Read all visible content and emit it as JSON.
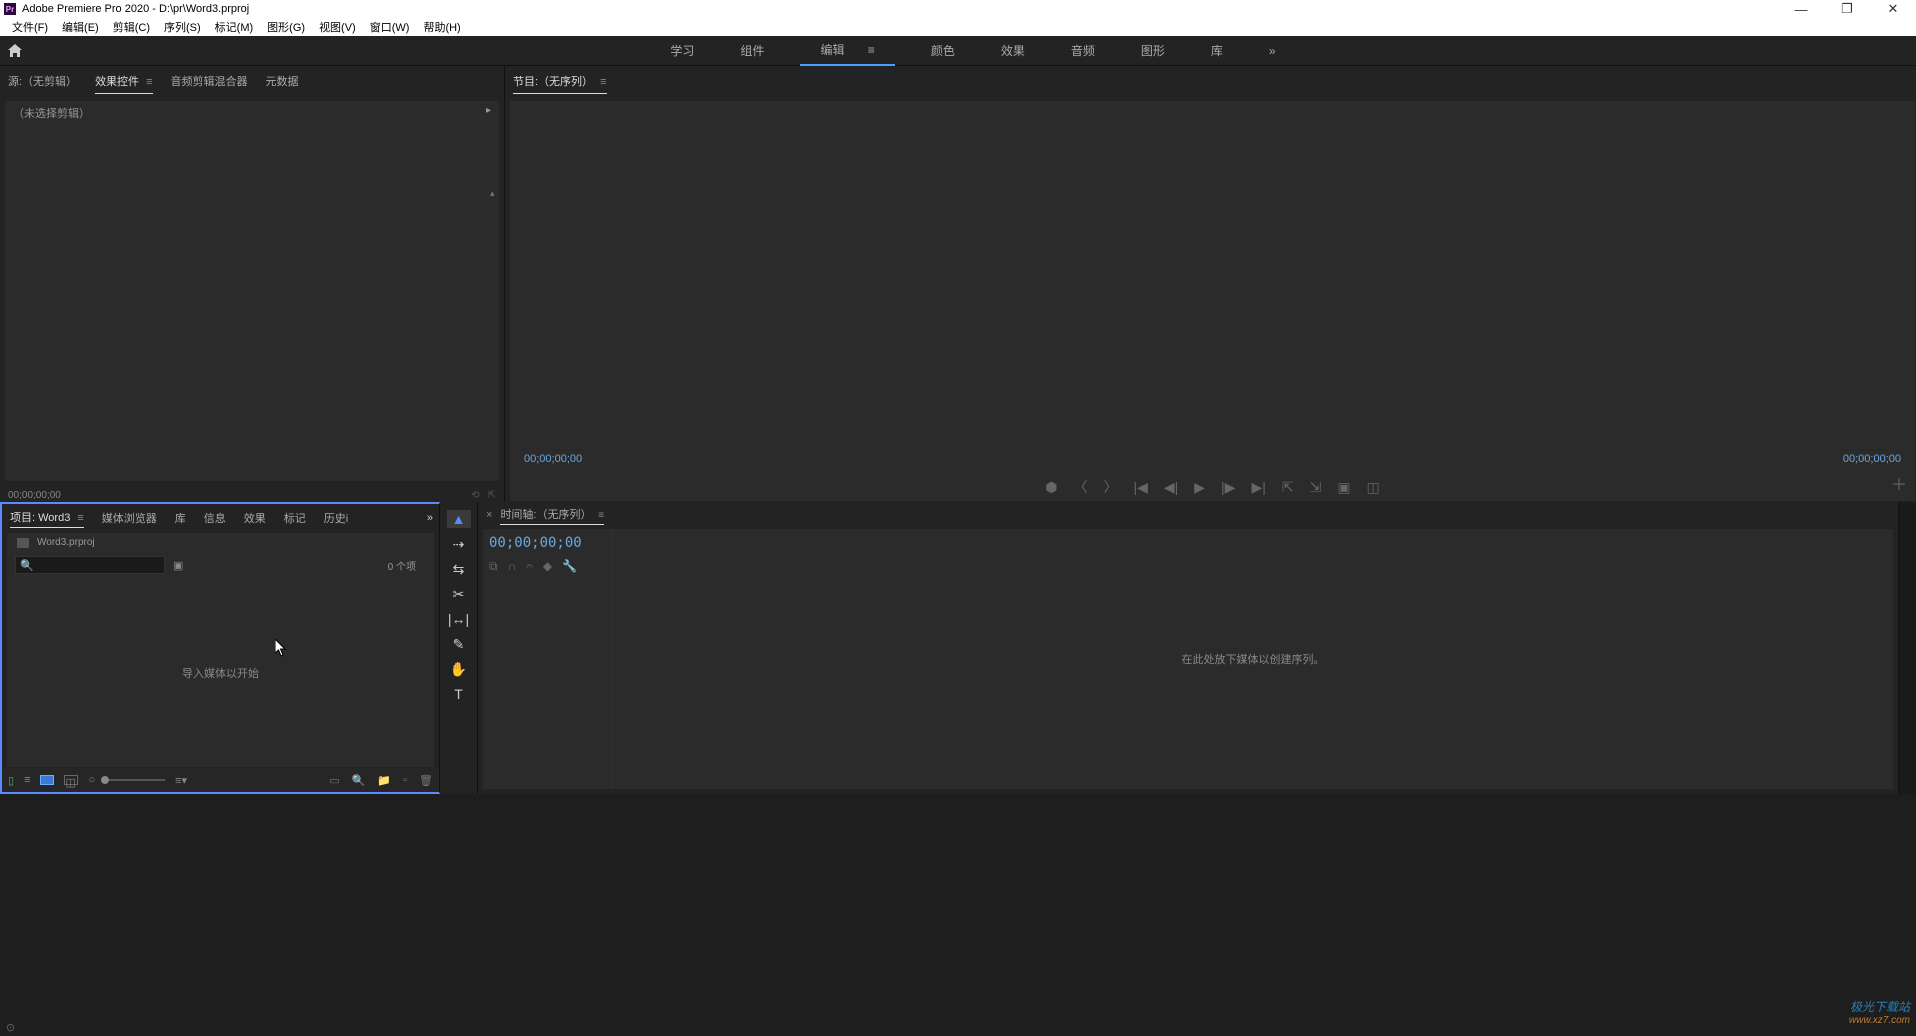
{
  "title": "Adobe Premiere Pro 2020 - D:\\pr\\Word3.prproj",
  "menus": [
    "文件(F)",
    "编辑(E)",
    "剪辑(C)",
    "序列(S)",
    "标记(M)",
    "图形(G)",
    "视图(V)",
    "窗口(W)",
    "帮助(H)"
  ],
  "workspace": {
    "tabs": [
      "学习",
      "组件",
      "编辑",
      "颜色",
      "效果",
      "音频",
      "图形",
      "库"
    ],
    "active": "编辑"
  },
  "source": {
    "tabs": [
      "源:（无剪辑）",
      "效果控件",
      "音频剪辑混合器",
      "元数据"
    ],
    "active": "效果控件",
    "header": "（未选择剪辑）",
    "timecode": "00;00;00;00"
  },
  "program": {
    "tab": "节目:（无序列）",
    "timecode_left": "00;00;00;00",
    "timecode_right": "00;00;00;00"
  },
  "project": {
    "tabs": [
      "项目: Word3",
      "媒体浏览器",
      "库",
      "信息",
      "效果",
      "标记",
      "历史i"
    ],
    "active": "项目: Word3",
    "filename": "Word3.prproj",
    "item_count": "0 个项",
    "drop_hint": "导入媒体以开始"
  },
  "timeline": {
    "tab": "时间轴:（无序列）",
    "timecode": "00;00;00;00",
    "drop_hint": "在此处放下媒体以创建序列。"
  },
  "watermark": {
    "line1": "极光下载站",
    "line2": "www.xz7.com"
  }
}
